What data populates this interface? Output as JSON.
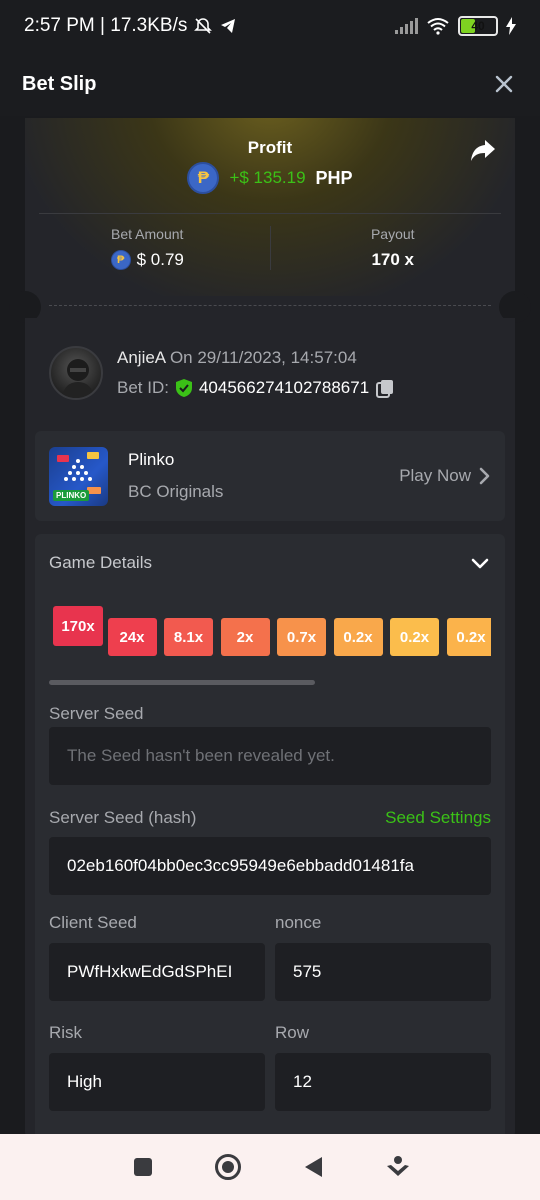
{
  "status_bar": {
    "left_text": "2:57 PM | 17.3KB/s",
    "battery": "40"
  },
  "header": {
    "title": "Bet Slip"
  },
  "profit": {
    "label": "Profit",
    "coin_symbol": "₱",
    "amount": "+$ 135.19",
    "currency": "PHP"
  },
  "stats": {
    "bet_amount_label": "Bet Amount",
    "bet_amount_value": "$ 0.79",
    "payout_label": "Payout",
    "payout_value": "170 x"
  },
  "user": {
    "name": "AnjieA",
    "date": "On 29/11/2023, 14:57:04",
    "bet_id_label": "Bet ID:",
    "bet_id": "404566274102788671"
  },
  "game": {
    "name": "Plinko",
    "provider": "BC Originals",
    "play_label": "Play Now",
    "thumb_tag": "PLINKO"
  },
  "details": {
    "title": "Game Details",
    "multipliers": [
      "170x",
      "24x",
      "8.1x",
      "2x",
      "0.7x",
      "0.2x",
      "0.2x",
      "0.2x"
    ],
    "multiplier_colors": [
      "#e8344e",
      "#ee3f4e",
      "#f25a4f",
      "#f4714c",
      "#f7924b",
      "#f9a84b",
      "#fbbd4c",
      "#fbb34b"
    ],
    "server_seed_label": "Server Seed",
    "server_seed_placeholder": "The Seed hasn't been revealed yet.",
    "server_seed_hash_label": "Server Seed (hash)",
    "seed_settings_label": "Seed Settings",
    "server_seed_hash": "02eb160f04bb0ec3cc95949e6ebbadd01481fa",
    "client_seed_label": "Client Seed",
    "client_seed": "PWfHxkwEdGdSPhEI",
    "nonce_label": "nonce",
    "nonce": "575",
    "risk_label": "Risk",
    "risk": "High",
    "row_label": "Row",
    "row": "12"
  },
  "colors": {
    "accent_green": "#3bc117",
    "coin_blue": "#3b67c6"
  }
}
